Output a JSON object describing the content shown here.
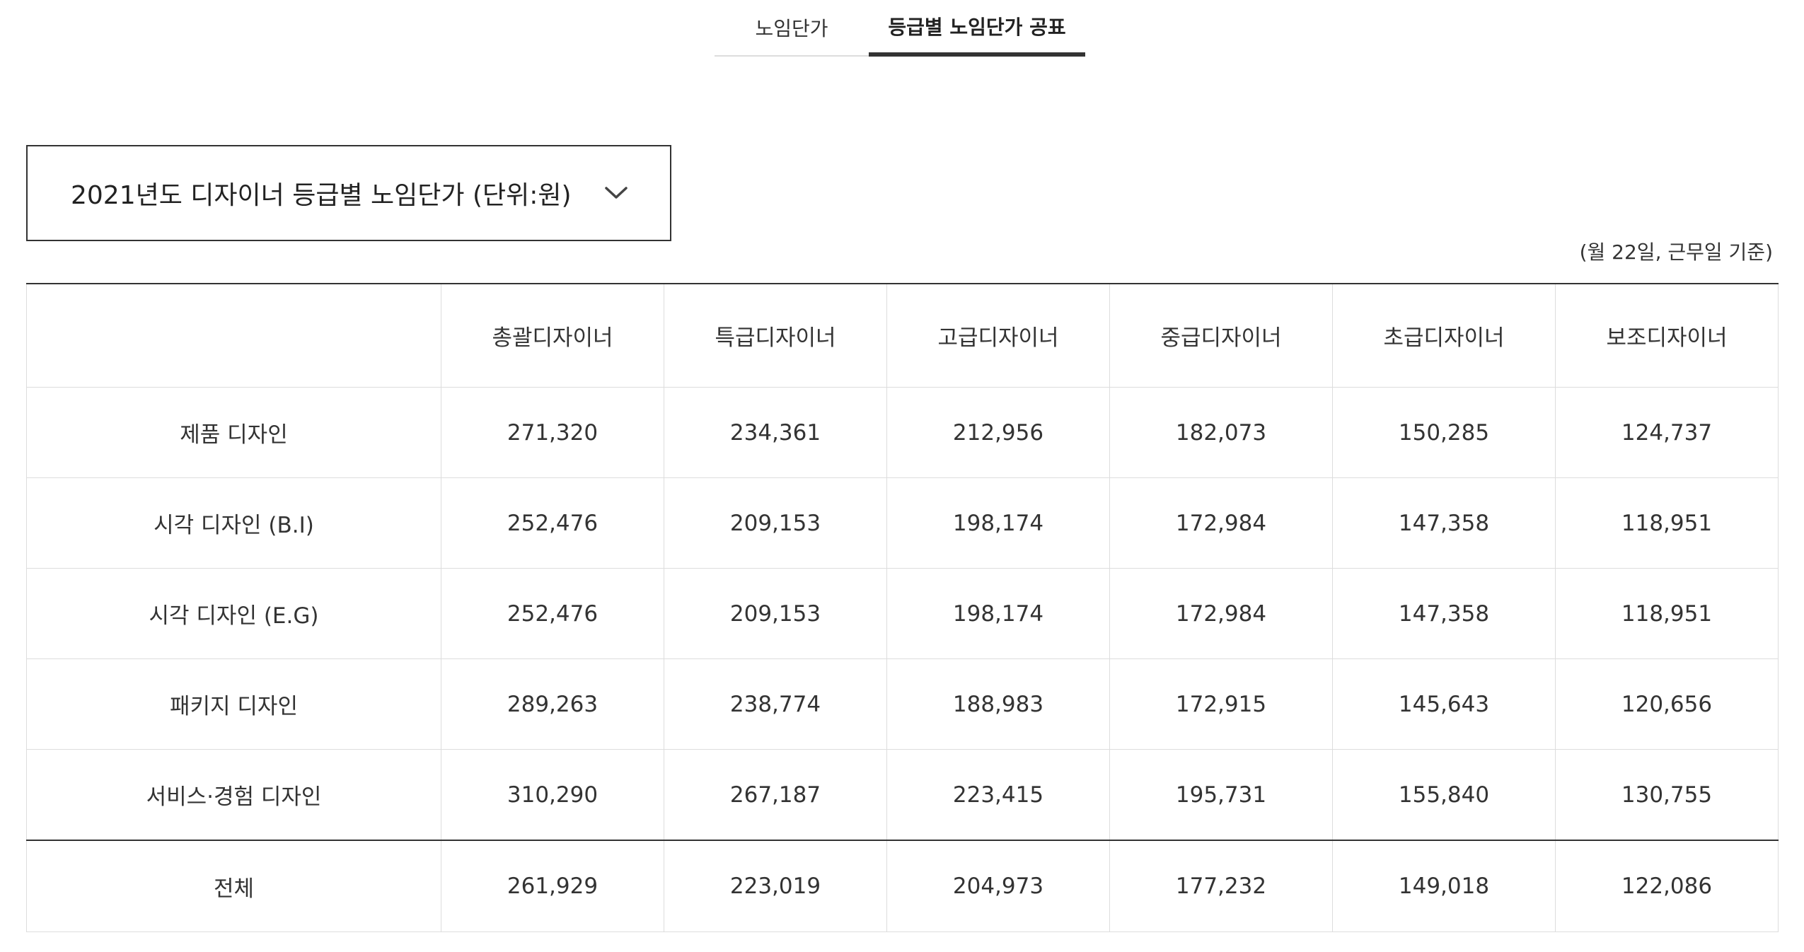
{
  "tabs": [
    {
      "label": "노임단가",
      "active": false
    },
    {
      "label": "등급별 노임단가 공표",
      "active": true
    }
  ],
  "dropdown": {
    "selected": "2021년도 디자이너 등급별 노임단가 (단위:원)",
    "icon": "chevron-down-icon"
  },
  "note": "(월 22일, 근무일 기준)",
  "table": {
    "headers": [
      "",
      "총괄디자이너",
      "특급디자이너",
      "고급디자이너",
      "중급디자이너",
      "초급디자이너",
      "보조디자이너"
    ],
    "rows": [
      {
        "category": "제품 디자인",
        "values": [
          "271,320",
          "234,361",
          "212,956",
          "182,073",
          "150,285",
          "124,737"
        ]
      },
      {
        "category": "시각 디자인 (B.I)",
        "values": [
          "252,476",
          "209,153",
          "198,174",
          "172,984",
          "147,358",
          "118,951"
        ]
      },
      {
        "category": "시각 디자인 (E.G)",
        "values": [
          "252,476",
          "209,153",
          "198,174",
          "172,984",
          "147,358",
          "118,951"
        ]
      },
      {
        "category": "패키지 디자인",
        "values": [
          "289,263",
          "238,774",
          "188,983",
          "172,915",
          "145,643",
          "120,656"
        ]
      },
      {
        "category": "서비스·경험 디자인",
        "values": [
          "310,290",
          "267,187",
          "223,415",
          "195,731",
          "155,840",
          "130,755"
        ]
      }
    ],
    "total": {
      "category": "전체",
      "values": [
        "261,929",
        "223,019",
        "204,973",
        "177,232",
        "149,018",
        "122,086"
      ]
    }
  },
  "colors": {
    "text": "#333333",
    "active_tab_underline": "#333333",
    "border_strong": "#333333",
    "border_light": "#dddddd"
  }
}
